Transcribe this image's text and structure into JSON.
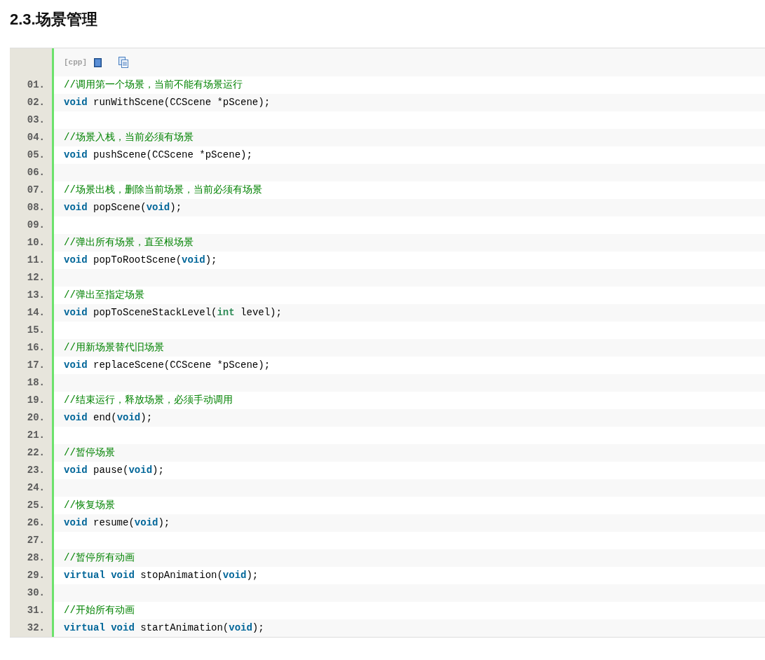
{
  "heading": "2.3.场景管理",
  "toolbar": {
    "language": "[cpp]"
  },
  "lines": [
    {
      "number": "01.",
      "tokens": [
        {
          "kind": "comment",
          "text": "//调用第一个场景，当前不能有场景运行"
        }
      ]
    },
    {
      "number": "02.",
      "tokens": [
        {
          "kind": "keyword",
          "text": "void"
        },
        {
          "kind": "plain",
          "text": " runWithScene(CCScene *pScene);"
        }
      ]
    },
    {
      "number": "03."
    },
    {
      "number": "04.",
      "tokens": [
        {
          "kind": "comment",
          "text": "//场景入栈，当前必须有场景"
        }
      ]
    },
    {
      "number": "05.",
      "tokens": [
        {
          "kind": "keyword",
          "text": "void"
        },
        {
          "kind": "plain",
          "text": " pushScene(CCScene *pScene);"
        }
      ]
    },
    {
      "number": "06."
    },
    {
      "number": "07.",
      "tokens": [
        {
          "kind": "comment",
          "text": "//场景出栈，删除当前场景，当前必须有场景"
        }
      ]
    },
    {
      "number": "08.",
      "tokens": [
        {
          "kind": "keyword",
          "text": "void"
        },
        {
          "kind": "plain",
          "text": " popScene("
        },
        {
          "kind": "keyword",
          "text": "void"
        },
        {
          "kind": "plain",
          "text": ");"
        }
      ]
    },
    {
      "number": "09."
    },
    {
      "number": "10.",
      "tokens": [
        {
          "kind": "comment",
          "text": "//弹出所有场景，直至根场景"
        }
      ]
    },
    {
      "number": "11.",
      "tokens": [
        {
          "kind": "keyword",
          "text": "void"
        },
        {
          "kind": "plain",
          "text": " popToRootScene("
        },
        {
          "kind": "keyword",
          "text": "void"
        },
        {
          "kind": "plain",
          "text": ");"
        }
      ]
    },
    {
      "number": "12."
    },
    {
      "number": "13.",
      "tokens": [
        {
          "kind": "comment",
          "text": "//弹出至指定场景"
        }
      ]
    },
    {
      "number": "14.",
      "tokens": [
        {
          "kind": "keyword",
          "text": "void"
        },
        {
          "kind": "plain",
          "text": " popToSceneStackLevel("
        },
        {
          "kind": "type",
          "text": "int"
        },
        {
          "kind": "plain",
          "text": " level);"
        }
      ]
    },
    {
      "number": "15."
    },
    {
      "number": "16.",
      "tokens": [
        {
          "kind": "comment",
          "text": "//用新场景替代旧场景"
        }
      ]
    },
    {
      "number": "17.",
      "tokens": [
        {
          "kind": "keyword",
          "text": "void"
        },
        {
          "kind": "plain",
          "text": " replaceScene(CCScene *pScene);"
        }
      ]
    },
    {
      "number": "18."
    },
    {
      "number": "19.",
      "tokens": [
        {
          "kind": "comment",
          "text": "//结束运行，释放场景，必须手动调用"
        }
      ]
    },
    {
      "number": "20.",
      "tokens": [
        {
          "kind": "keyword",
          "text": "void"
        },
        {
          "kind": "plain",
          "text": " end("
        },
        {
          "kind": "keyword",
          "text": "void"
        },
        {
          "kind": "plain",
          "text": ");"
        }
      ]
    },
    {
      "number": "21."
    },
    {
      "number": "22.",
      "tokens": [
        {
          "kind": "comment",
          "text": "//暂停场景"
        }
      ]
    },
    {
      "number": "23.",
      "tokens": [
        {
          "kind": "keyword",
          "text": "void"
        },
        {
          "kind": "plain",
          "text": " pause("
        },
        {
          "kind": "keyword",
          "text": "void"
        },
        {
          "kind": "plain",
          "text": ");"
        }
      ]
    },
    {
      "number": "24."
    },
    {
      "number": "25.",
      "tokens": [
        {
          "kind": "comment",
          "text": "//恢复场景"
        }
      ]
    },
    {
      "number": "26.",
      "tokens": [
        {
          "kind": "keyword",
          "text": "void"
        },
        {
          "kind": "plain",
          "text": " resume("
        },
        {
          "kind": "keyword",
          "text": "void"
        },
        {
          "kind": "plain",
          "text": ");"
        }
      ]
    },
    {
      "number": "27."
    },
    {
      "number": "28.",
      "tokens": [
        {
          "kind": "comment",
          "text": "//暂停所有动画"
        }
      ]
    },
    {
      "number": "29.",
      "tokens": [
        {
          "kind": "keyword",
          "text": "virtual void"
        },
        {
          "kind": "plain",
          "text": " stopAnimation("
        },
        {
          "kind": "keyword",
          "text": "void"
        },
        {
          "kind": "plain",
          "text": ");"
        }
      ]
    },
    {
      "number": "30."
    },
    {
      "number": "31.",
      "tokens": [
        {
          "kind": "comment",
          "text": "//开始所有动画"
        }
      ]
    },
    {
      "number": "32.",
      "tokens": [
        {
          "kind": "keyword",
          "text": "virtual void"
        },
        {
          "kind": "plain",
          "text": " startAnimation("
        },
        {
          "kind": "keyword",
          "text": "void"
        },
        {
          "kind": "plain",
          "text": ");"
        }
      ]
    }
  ]
}
